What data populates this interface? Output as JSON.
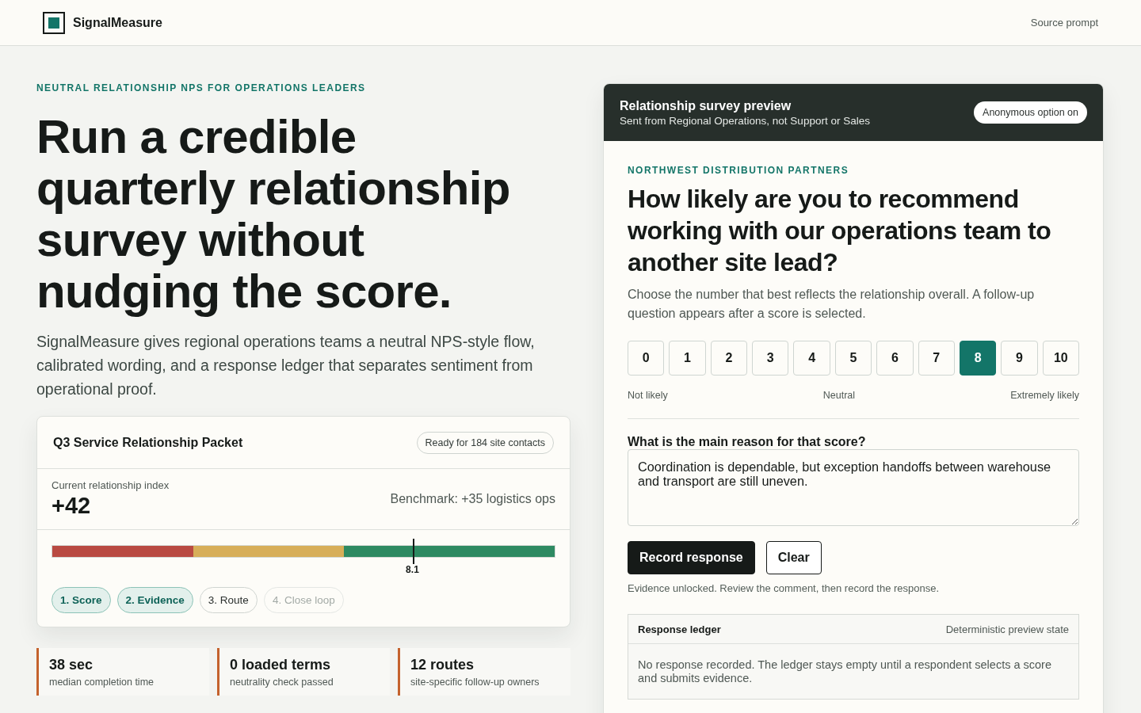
{
  "header": {
    "brand": "SignalMeasure",
    "link": "Source prompt"
  },
  "hero": {
    "eyebrow": "NEUTRAL RELATIONSHIP NPS FOR OPERATIONS LEADERS",
    "headline": "Run a credible quarterly relationship survey without nudging the score.",
    "lede": "SignalMeasure gives regional operations teams a neutral NPS-style flow, calibrated wording, and a response ledger that separates sentiment from operational proof."
  },
  "packet": {
    "title": "Q3 Service Relationship Packet",
    "badge": "Ready for 184 site contacts",
    "index_label": "Current relationship index",
    "index_value": "+42",
    "benchmark": "Benchmark: +35 logistics ops",
    "meter": {
      "level": 0.72,
      "reading": "8.1"
    },
    "steps": [
      {
        "label": "1. Score",
        "done": true,
        "disabled": false
      },
      {
        "label": "2. Evidence",
        "done": true,
        "disabled": false
      },
      {
        "label": "3. Route",
        "done": false,
        "disabled": false
      },
      {
        "label": "4. Close loop",
        "done": false,
        "disabled": true
      }
    ]
  },
  "stats": [
    {
      "value": "38 sec",
      "label": "median completion time"
    },
    {
      "value": "0 loaded terms",
      "label": "neutrality check passed"
    },
    {
      "value": "12 routes",
      "label": "site-specific follow-up owners"
    }
  ],
  "survey": {
    "title": "Relationship survey preview",
    "subtitle": "Sent from Regional Operations, not Support or Sales",
    "badge": "Anonymous option on",
    "eyebrow": "NORTHWEST DISTRIBUTION PARTNERS",
    "question": "How likely are you to recommend working with our operations team to another site lead?",
    "description": "Choose the number that best reflects the relationship overall. A follow-up question appears after a score is selected.",
    "scale": [
      {
        "label": "0",
        "selected": false
      },
      {
        "label": "1",
        "selected": false
      },
      {
        "label": "2",
        "selected": false
      },
      {
        "label": "3",
        "selected": false
      },
      {
        "label": "4",
        "selected": false
      },
      {
        "label": "5",
        "selected": false
      },
      {
        "label": "6",
        "selected": false
      },
      {
        "label": "7",
        "selected": false
      },
      {
        "label": "8",
        "selected": true
      },
      {
        "label": "9",
        "selected": false
      },
      {
        "label": "10",
        "selected": false
      }
    ],
    "scale_labels": [
      "Not likely",
      "Neutral",
      "Extremely likely"
    ],
    "follow_up": {
      "label": "What is the main reason for that score?",
      "value": "Coordination is dependable, but exception handoffs between warehouse and transport are still uneven."
    },
    "buttons": [
      {
        "label": "Record response",
        "kind": "primary"
      },
      {
        "label": "Clear",
        "kind": "secondary"
      }
    ],
    "hint": "Evidence unlocked. Review the comment, then record the response.",
    "ledger": {
      "title": "Response ledger",
      "status": "Deterministic preview state",
      "message": "No response recorded. The ledger stays empty until a respondent selects a score and submits evidence."
    }
  }
}
